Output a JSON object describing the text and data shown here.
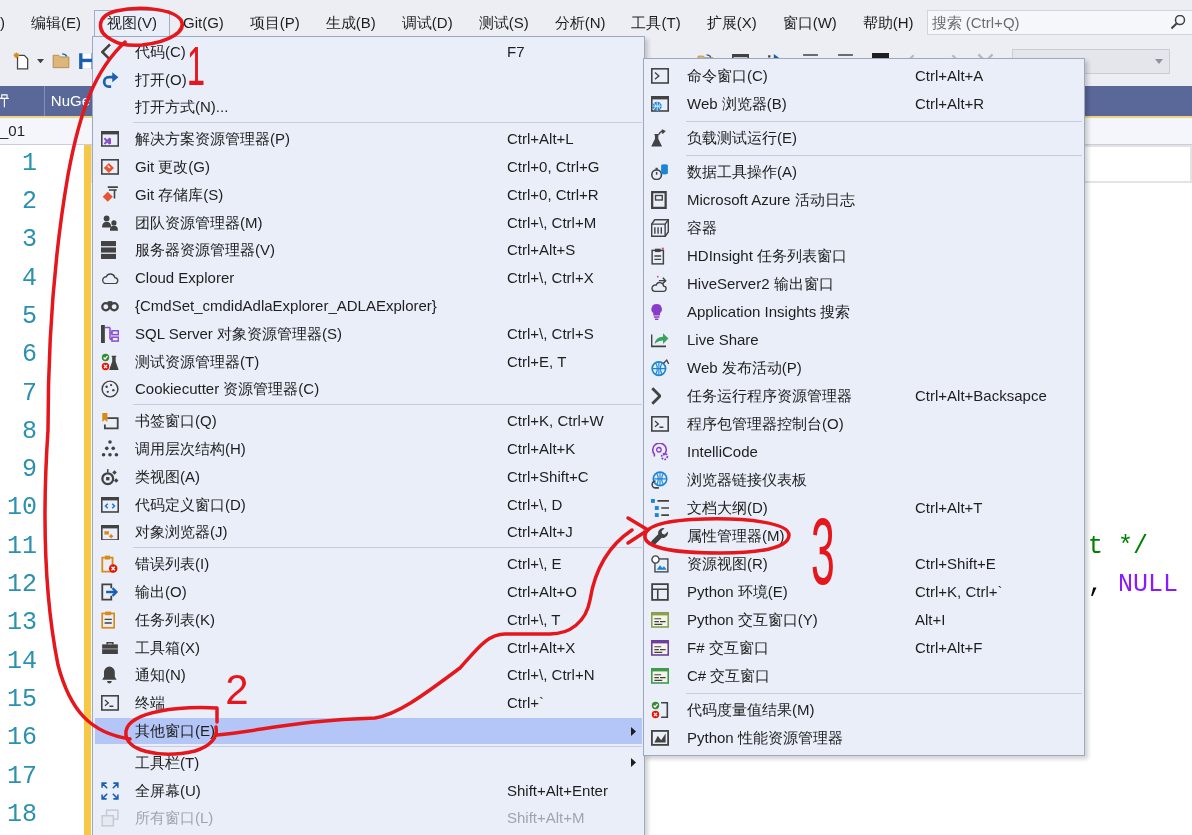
{
  "menu_bar": {
    "items": [
      {
        "label": ")",
        "selected": false
      },
      {
        "label": "编辑(E)",
        "selected": false
      },
      {
        "label": "视图(V)",
        "selected": true
      },
      {
        "label": "Git(G)",
        "selected": false
      },
      {
        "label": "项目(P)",
        "selected": false
      },
      {
        "label": "生成(B)",
        "selected": false
      },
      {
        "label": "调试(D)",
        "selected": false
      },
      {
        "label": "测试(S)",
        "selected": false
      },
      {
        "label": "分析(N)",
        "selected": false
      },
      {
        "label": "工具(T)",
        "selected": false
      },
      {
        "label": "扩展(X)",
        "selected": false
      },
      {
        "label": "窗口(W)",
        "selected": false
      },
      {
        "label": "帮助(H)",
        "selected": false
      }
    ],
    "search": {
      "placeholder": "搜索 (Ctrl+Q)"
    }
  },
  "document_tabs": [
    {
      "label": "NuGe"
    }
  ],
  "navigation_bar": {
    "project": "_01"
  },
  "editor": {
    "lines": [
      {
        "number": "1",
        "current": true
      },
      {
        "number": "2",
        "current": false
      },
      {
        "number": "3",
        "current": false
      },
      {
        "number": "4",
        "current": false
      },
      {
        "number": "5",
        "current": false
      },
      {
        "number": "6",
        "current": false
      },
      {
        "number": "7",
        "current": false
      },
      {
        "number": "8",
        "current": false
      },
      {
        "number": "9",
        "current": false
      },
      {
        "number": "10",
        "current": false
      },
      {
        "number": "11",
        "current": false,
        "tokens": [
          {
            "kind": "comment",
            "text": "t */"
          }
        ]
      },
      {
        "number": "12",
        "current": false,
        "tokens": [
          {
            "kind": "plain",
            "text": ","
          },
          {
            "kind": "macro",
            "text": "NULL"
          }
        ]
      },
      {
        "number": "13",
        "current": false
      },
      {
        "number": "14",
        "current": false
      },
      {
        "number": "15",
        "current": false
      },
      {
        "number": "16",
        "current": false
      },
      {
        "number": "17",
        "current": false
      },
      {
        "number": "18",
        "current": false
      }
    ]
  },
  "view_menu": {
    "items": [
      {
        "kind": "item",
        "label": "代码(C)",
        "shortcut": "F7",
        "selected": false,
        "disabled": false
      },
      {
        "kind": "item",
        "label": "打开(O)",
        "selected": false,
        "disabled": false
      },
      {
        "kind": "item",
        "label": "打开方式(N)...",
        "selected": false,
        "disabled": false
      },
      {
        "kind": "separator"
      },
      {
        "kind": "item",
        "label": "解决方案资源管理器(P)",
        "shortcut": "Ctrl+Alt+L",
        "selected": false,
        "disabled": false
      },
      {
        "kind": "item",
        "label": "Git 更改(G)",
        "shortcut": "Ctrl+0, Ctrl+G",
        "selected": false,
        "disabled": false
      },
      {
        "kind": "item",
        "label": "Git 存储库(S)",
        "shortcut": "Ctrl+0, Ctrl+R",
        "selected": false,
        "disabled": false
      },
      {
        "kind": "item",
        "label": "团队资源管理器(M)",
        "shortcut": "Ctrl+\\, Ctrl+M",
        "selected": false,
        "disabled": false
      },
      {
        "kind": "item",
        "label": "服务器资源管理器(V)",
        "shortcut": "Ctrl+Alt+S",
        "selected": false,
        "disabled": false
      },
      {
        "kind": "item",
        "label": "Cloud Explorer",
        "shortcut": "Ctrl+\\, Ctrl+X",
        "selected": false,
        "disabled": false
      },
      {
        "kind": "item",
        "label": "{CmdSet_cmdidAdlaExplorer_ADLAExplorer}",
        "selected": false,
        "disabled": false
      },
      {
        "kind": "item",
        "label": "SQL Server 对象资源管理器(S)",
        "shortcut": "Ctrl+\\, Ctrl+S",
        "selected": false,
        "disabled": false
      },
      {
        "kind": "item",
        "label": "测试资源管理器(T)",
        "shortcut": "Ctrl+E, T",
        "selected": false,
        "disabled": false
      },
      {
        "kind": "item",
        "label": "Cookiecutter 资源管理器(C)",
        "selected": false,
        "disabled": false
      },
      {
        "kind": "separator"
      },
      {
        "kind": "item",
        "label": "书签窗口(Q)",
        "shortcut": "Ctrl+K, Ctrl+W",
        "selected": false,
        "disabled": false
      },
      {
        "kind": "item",
        "label": "调用层次结构(H)",
        "shortcut": "Ctrl+Alt+K",
        "selected": false,
        "disabled": false
      },
      {
        "kind": "item",
        "label": "类视图(A)",
        "shortcut": "Ctrl+Shift+C",
        "selected": false,
        "disabled": false
      },
      {
        "kind": "item",
        "label": "代码定义窗口(D)",
        "shortcut": "Ctrl+\\, D",
        "selected": false,
        "disabled": false
      },
      {
        "kind": "item",
        "label": "对象浏览器(J)",
        "shortcut": "Ctrl+Alt+J",
        "selected": false,
        "disabled": false
      },
      {
        "kind": "separator"
      },
      {
        "kind": "item",
        "label": "错误列表(I)",
        "shortcut": "Ctrl+\\, E",
        "selected": false,
        "disabled": false
      },
      {
        "kind": "item",
        "label": "输出(O)",
        "shortcut": "Ctrl+Alt+O",
        "selected": false,
        "disabled": false
      },
      {
        "kind": "item",
        "label": "任务列表(K)",
        "shortcut": "Ctrl+\\, T",
        "selected": false,
        "disabled": false
      },
      {
        "kind": "item",
        "label": "工具箱(X)",
        "shortcut": "Ctrl+Alt+X",
        "selected": false,
        "disabled": false
      },
      {
        "kind": "item",
        "label": "通知(N)",
        "shortcut": "Ctrl+\\, Ctrl+N",
        "selected": false,
        "disabled": false
      },
      {
        "kind": "item",
        "label": "终端",
        "shortcut": "Ctrl+`",
        "selected": false,
        "disabled": false
      },
      {
        "kind": "submenu",
        "label": "其他窗口(E)",
        "selected": true,
        "disabled": false
      },
      {
        "kind": "separator"
      },
      {
        "kind": "submenu",
        "label": "工具栏(T)",
        "selected": false,
        "disabled": false
      },
      {
        "kind": "item",
        "label": "全屏幕(U)",
        "shortcut": "Shift+Alt+Enter",
        "selected": false,
        "disabled": false
      },
      {
        "kind": "item",
        "label": "所有窗口(L)",
        "shortcut": "Shift+Alt+M",
        "selected": false,
        "disabled": true
      }
    ]
  },
  "other_windows_menu": {
    "items": [
      {
        "kind": "item",
        "label": "命令窗口(C)",
        "shortcut": "Ctrl+Alt+A"
      },
      {
        "kind": "item",
        "label": "Web 浏览器(B)",
        "shortcut": "Ctrl+Alt+R"
      },
      {
        "kind": "separator"
      },
      {
        "kind": "item",
        "label": "负载测试运行(E)"
      },
      {
        "kind": "separator"
      },
      {
        "kind": "item",
        "label": "数据工具操作(A)"
      },
      {
        "kind": "item",
        "label": "Microsoft Azure 活动日志"
      },
      {
        "kind": "item",
        "label": "容器"
      },
      {
        "kind": "item",
        "label": "HDInsight 任务列表窗口"
      },
      {
        "kind": "item",
        "label": "HiveServer2 输出窗口"
      },
      {
        "kind": "item",
        "label": "Application Insights 搜索"
      },
      {
        "kind": "item",
        "label": "Live Share"
      },
      {
        "kind": "item",
        "label": "Web 发布活动(P)"
      },
      {
        "kind": "item",
        "label": "任务运行程序资源管理器",
        "shortcut": "Ctrl+Alt+Backsapce"
      },
      {
        "kind": "item",
        "label": "程序包管理器控制台(O)"
      },
      {
        "kind": "item",
        "label": "IntelliCode"
      },
      {
        "kind": "item",
        "label": "浏览器链接仪表板"
      },
      {
        "kind": "item",
        "label": "文档大纲(D)",
        "shortcut": "Ctrl+Alt+T"
      },
      {
        "kind": "item",
        "label": "属性管理器(M)"
      },
      {
        "kind": "item",
        "label": "资源视图(R)",
        "shortcut": "Ctrl+Shift+E"
      },
      {
        "kind": "item",
        "label": "Python 环境(E)",
        "shortcut": "Ctrl+K, Ctrl+`"
      },
      {
        "kind": "item",
        "label": "Python 交互窗口(Y)",
        "shortcut": "Alt+I"
      },
      {
        "kind": "item",
        "label": "F# 交互窗口",
        "shortcut": "Ctrl+Alt+F"
      },
      {
        "kind": "item",
        "label": "C# 交互窗口"
      },
      {
        "kind": "separator"
      },
      {
        "kind": "item",
        "label": "代码度量值结果(M)"
      },
      {
        "kind": "item",
        "label": "Python 性能资源管理器"
      }
    ]
  },
  "annotations": [
    {
      "text": "1"
    },
    {
      "text": "2"
    },
    {
      "text": "3"
    }
  ]
}
